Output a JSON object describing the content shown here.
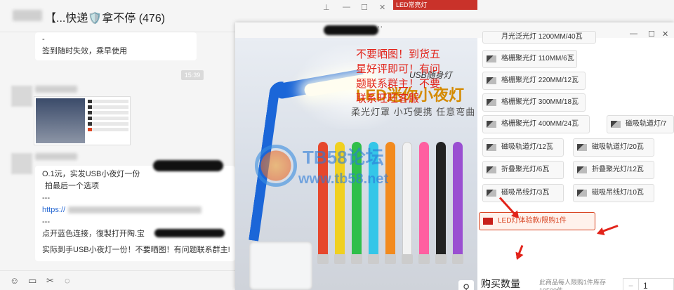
{
  "chat": {
    "title": "【...快递🛡️拿不停 (476)",
    "msg1_dash": "-",
    "msg1_text": "签到随时失效，乘早使用",
    "time": "15:39",
    "msg3": {
      "line1": "O.1沅，实发USB小夜灯一份",
      "line2": "拍最后一个选项",
      "sep1": "---",
      "link_prefix": "https://",
      "sep2": "---",
      "line3": "点开蓝色连接，復製打开陶.宝",
      "line4": "实际到手USB小夜灯一份！不要晒图！有问题联系群主!"
    }
  },
  "toolbar": {
    "icons": [
      "smile-icon",
      "folder-icon",
      "scissors-icon",
      "chat-icon"
    ]
  },
  "viewer": {
    "dots": "...",
    "top_strip": "LED常亮灯",
    "product": {
      "small_tag": "USB随身灯",
      "main_title": "LED迷你小夜灯",
      "subtitle": "柔光灯罩 小巧便携 任意弯曲",
      "watermark_title": "TB58论坛",
      "watermark_url": "www.tb58.net",
      "stick_colors": [
        "#e6472c",
        "#f0d020",
        "#2fbf4a",
        "#34c6e8",
        "#f28a1e",
        "#f2f2f2",
        "#ff5fa0",
        "#222222",
        "#9a4fd1"
      ]
    },
    "options": [
      "格栅聚光灯 110MM/6瓦",
      "格栅聚光灯 220MM/12瓦",
      "格栅聚光灯 300MM/18瓦",
      "格栅聚光灯 400MM/24瓦",
      "磁吸轨道灯/7",
      "磁吸轨道灯/12瓦",
      "磁吸轨道灯/20瓦",
      "折叠聚光灯/6瓦",
      "折叠聚光灯/12瓦",
      "磁吸吊线灯/3瓦",
      "磁吸吊线灯/10瓦",
      "LED灯体验款/限购1件"
    ],
    "top_partial": "月光泛光灯 1200MM/40瓦",
    "buy_label": "购买数量",
    "buy_note": "此商品每人限购1件库存10500件",
    "qty_minus": "−",
    "qty_value": "1",
    "annotation": "不要晒图！到货五星好评即可！有问题联系群主！不要联系旺旺客服",
    "accent": "#e2231a"
  }
}
